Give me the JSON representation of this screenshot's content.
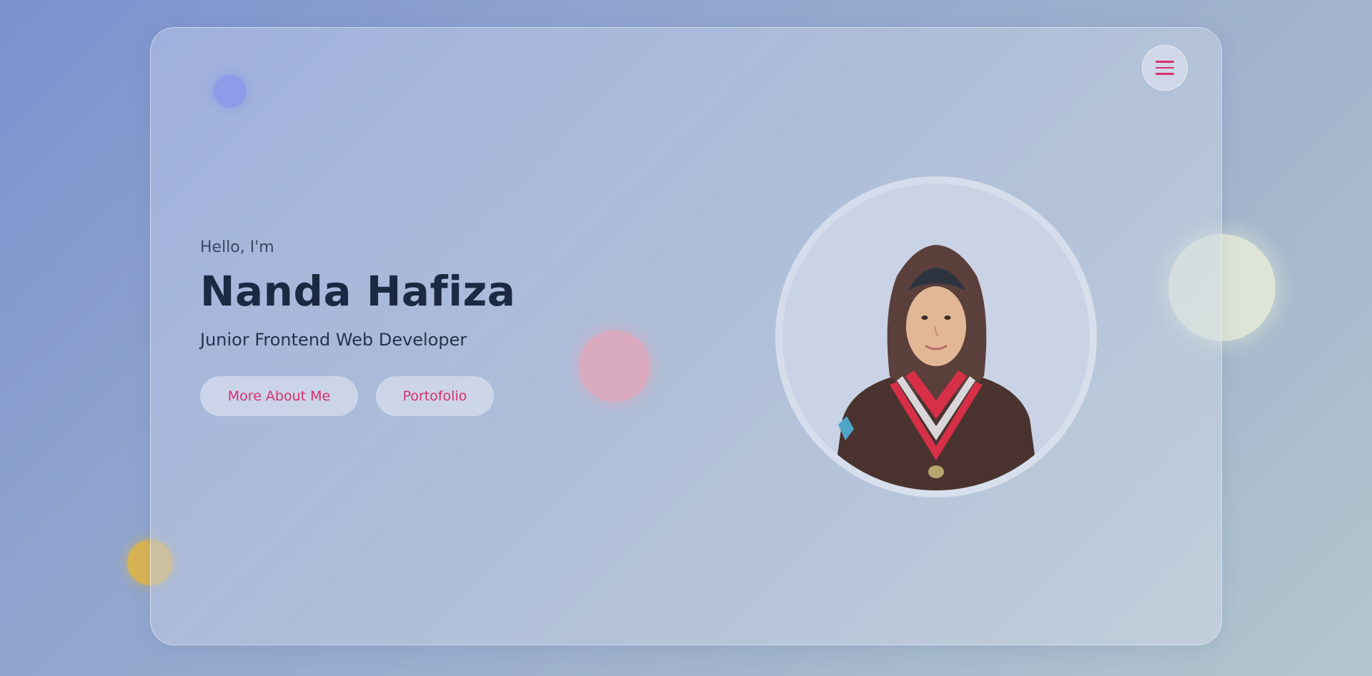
{
  "hero": {
    "greeting": "Hello, I'm",
    "name": "Nanda Hafiza",
    "role": "Junior Frontend Web Developer",
    "buttons": {
      "about": "More About Me",
      "portfolio": "Portofolio"
    }
  },
  "icons": {
    "menu": "hamburger-menu-icon"
  },
  "colors": {
    "accent": "#d6306e",
    "heading": "#1b2942",
    "text": "#26324d"
  }
}
